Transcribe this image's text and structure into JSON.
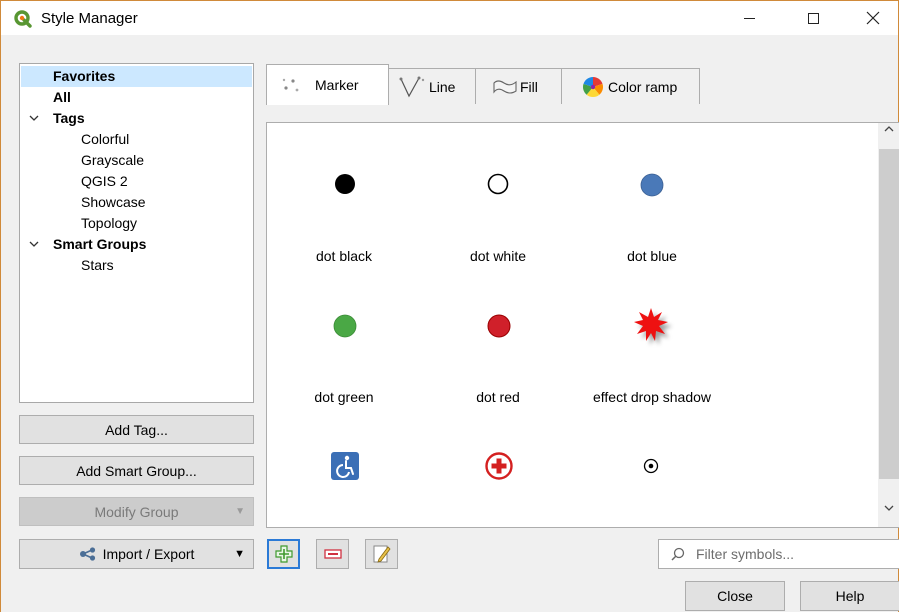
{
  "window": {
    "title": "Style Manager"
  },
  "tree": {
    "items": [
      {
        "label": "Favorites",
        "bold": true,
        "selected": true
      },
      {
        "label": "All",
        "bold": true
      },
      {
        "label": "Tags",
        "bold": true,
        "expanded": true
      },
      {
        "label": "Colorful"
      },
      {
        "label": "Grayscale"
      },
      {
        "label": "QGIS 2"
      },
      {
        "label": "Showcase"
      },
      {
        "label": "Topology"
      },
      {
        "label": "Smart Groups",
        "bold": true,
        "expanded": true
      },
      {
        "label": "Stars"
      }
    ]
  },
  "buttons": {
    "add_tag": "Add Tag...",
    "add_smart_group": "Add Smart Group...",
    "modify_group": "Modify Group",
    "import_export": "Import / Export",
    "close": "Close",
    "help": "Help"
  },
  "tabs": [
    {
      "label": "Marker",
      "active": true
    },
    {
      "label": "Line"
    },
    {
      "label": "Fill"
    },
    {
      "label": "Color ramp"
    }
  ],
  "symbols": [
    {
      "label": "dot  black",
      "icon": "black-dot",
      "color": "#000000"
    },
    {
      "label": "dot  white",
      "icon": "white-dot",
      "color": "#ffffff"
    },
    {
      "label": "dot blue",
      "icon": "blue-dot",
      "color": "#4a79b8"
    },
    {
      "label": "dot green",
      "icon": "green-dot",
      "color": "#4aa845"
    },
    {
      "label": "dot red",
      "icon": "red-dot",
      "color": "#d0202a"
    },
    {
      "label": "effect drop shadow",
      "icon": "red-star-shadow",
      "color": "#ee1111"
    },
    {
      "label": "",
      "icon": "accessibility",
      "color": "#3b6fb6"
    },
    {
      "label": "",
      "icon": "red-cross",
      "color": "#d42020"
    },
    {
      "label": "",
      "icon": "dot-in-circle",
      "color": "#000000"
    }
  ],
  "filter": {
    "placeholder": "Filter symbols..."
  }
}
